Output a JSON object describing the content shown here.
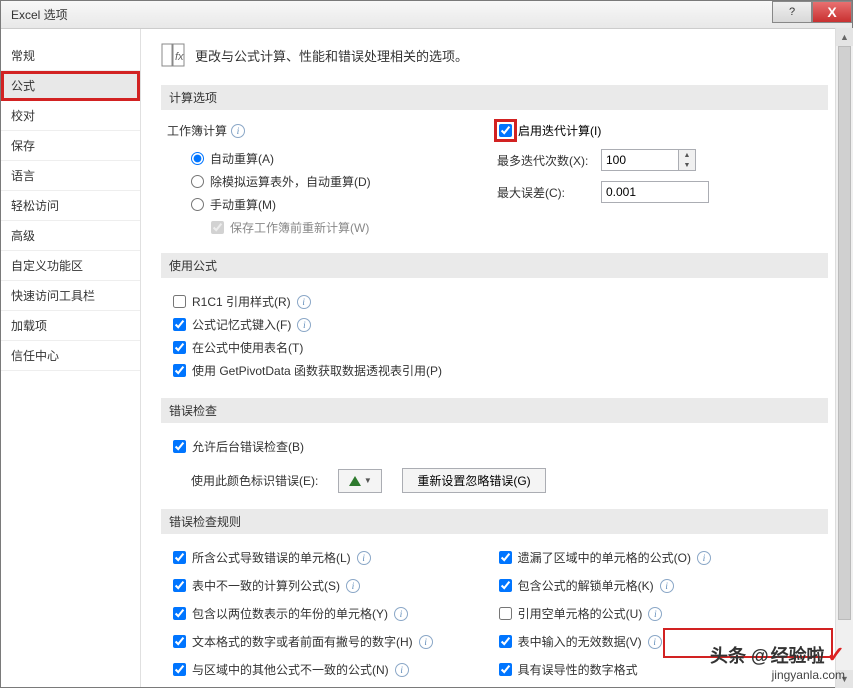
{
  "title": "Excel 选项",
  "titlebar": {
    "help": "?",
    "close": "X"
  },
  "sidebar": {
    "items": [
      {
        "label": "常规"
      },
      {
        "label": "公式"
      },
      {
        "label": "校对"
      },
      {
        "label": "保存"
      },
      {
        "label": "语言"
      },
      {
        "label": "轻松访问"
      },
      {
        "label": "高级"
      },
      {
        "label": "自定义功能区"
      },
      {
        "label": "快速访问工具栏"
      },
      {
        "label": "加载项"
      },
      {
        "label": "信任中心"
      }
    ],
    "selected_index": 1
  },
  "page_desc": "更改与公式计算、性能和错误处理相关的选项。",
  "sections": {
    "calc_header": "计算选项",
    "workbook_calc_label": "工作簿计算",
    "radios": {
      "auto": "自动重算(A)",
      "auto_except": "除模拟运算表外，自动重算(D)",
      "manual": "手动重算(M)"
    },
    "recalc_before_save": "保存工作簿前重新计算(W)",
    "enable_iter": "启用迭代计算(I)",
    "max_iter_label": "最多迭代次数(X):",
    "max_iter_value": "100",
    "max_change_label": "最大误差(C):",
    "max_change_value": "0.001",
    "use_formula_header": "使用公式",
    "formula_checks": {
      "r1c1": "R1C1 引用样式(R)",
      "autocomplete": "公式记忆式键入(F)",
      "table_names": "在公式中使用表名(T)",
      "getpivot": "使用 GetPivotData 函数获取数据透视表引用(P)"
    },
    "error_check_header": "错误检查",
    "enable_bg_error": "允许后台错误检查(B)",
    "error_color_label": "使用此颜色标识错误(E):",
    "reset_ignored": "重新设置忽略错误(G)",
    "rules_header": "错误检查规则",
    "rules_left": [
      "所含公式导致错误的单元格(L)",
      "表中不一致的计算列公式(S)",
      "包含以两位数表示的年份的单元格(Y)",
      "文本格式的数字或者前面有撇号的数字(H)",
      "与区域中的其他公式不一致的公式(N)"
    ],
    "rules_right": [
      "遗漏了区域中的单元格的公式(O)",
      "包含公式的解锁单元格(K)",
      "引用空单元格的公式(U)",
      "表中输入的无效数据(V)",
      "具有误导性的数字格式"
    ]
  },
  "watermark": {
    "prefix": "头条 @",
    "brand": "经验啦",
    "site": "jingyanla.com"
  }
}
